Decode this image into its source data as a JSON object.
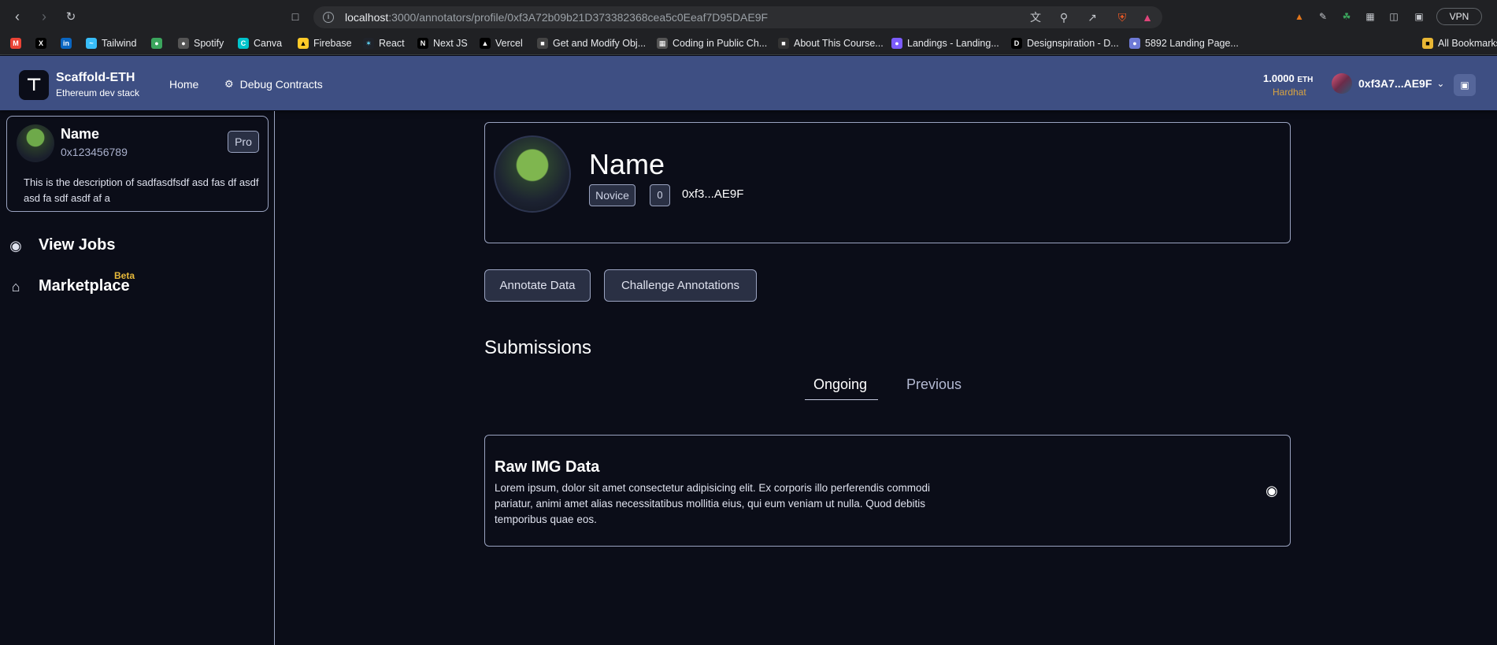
{
  "browser": {
    "url_host": "localhost",
    "url_path": ":3000/annotators/profile/0xf3A72b09b21D373382368cea5c0Eeaf7D95DAE9F",
    "vpn_label": "VPN",
    "bookmarks": [
      {
        "label": "Tailwind",
        "icon": "tailwind-icon"
      },
      {
        "label": "Spotify",
        "icon": "spotify-icon"
      },
      {
        "label": "Canva",
        "icon": "canva-icon"
      },
      {
        "label": "Firebase",
        "icon": "firebase-icon"
      },
      {
        "label": "React",
        "icon": "react-icon"
      },
      {
        "label": "Next JS",
        "icon": "nextjs-icon"
      },
      {
        "label": "Vercel",
        "icon": "vercel-icon"
      },
      {
        "label": "Get and Modify Obj...",
        "icon": "bookmark-icon"
      },
      {
        "label": "Coding in Public Ch...",
        "icon": "bookmark-icon"
      },
      {
        "label": "About This Course...",
        "icon": "bookmark-icon"
      },
      {
        "label": "Landings - Landing...",
        "icon": "bookmark-icon"
      },
      {
        "label": "Designspiration - D...",
        "icon": "bookmark-icon"
      },
      {
        "label": "5892 Landing Page...",
        "icon": "bookmark-icon"
      }
    ],
    "all_bookmarks": "All Bookmarks"
  },
  "header": {
    "brand_title": "Scaffold-ETH",
    "brand_subtitle": "Ethereum dev stack",
    "nav": [
      "Home",
      "Debug Contracts"
    ],
    "balance": "1.0000",
    "balance_unit": "ETH",
    "network": "Hardhat",
    "wallet_address": "0xf3A7...AE9F"
  },
  "sidebar": {
    "profile": {
      "name": "Name",
      "address": "0x123456789",
      "badge": "Pro",
      "description": "This is the description of sadfasdfsdf asd fas df asdf asd fa sdf asdf af a"
    },
    "items": [
      {
        "label": "View Jobs",
        "icon": "eye-icon"
      },
      {
        "label": "Marketplace",
        "icon": "store-icon",
        "tag": "Beta"
      }
    ]
  },
  "main": {
    "profile": {
      "name": "Name",
      "level": "Novice",
      "count": "0",
      "address": "0xf3...AE9F"
    },
    "actions": [
      "Annotate Data",
      "Challenge Annotations"
    ],
    "section_title": "Submissions",
    "tabs": [
      "Ongoing",
      "Previous"
    ],
    "active_tab": "Ongoing",
    "jobs": [
      {
        "title": "Raw IMG Data",
        "description": "Lorem ipsum, dolor sit amet consectetur adipisicing elit. Ex corporis illo perferendis commodi pariatur, animi amet alias necessitatibus mollitia eius, qui eum veniam ut nulla. Quod debitis temporibus quae eos."
      }
    ]
  },
  "colors": {
    "background": "#0b0d18",
    "header": "#3e4f83",
    "border": "#9aa3c0",
    "accent_yellow": "#e7b93a"
  }
}
